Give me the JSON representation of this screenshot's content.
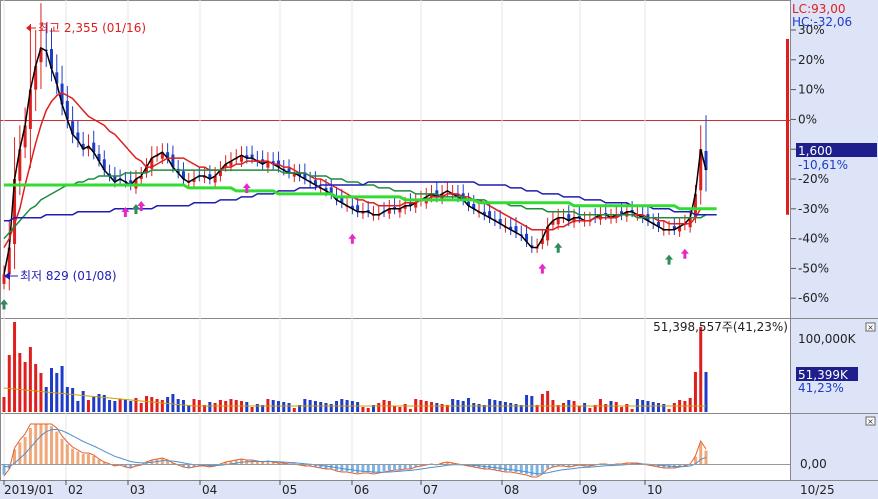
{
  "colors": {
    "up": "#e01e1e",
    "down": "#1e3cc8",
    "ma5": "#000000",
    "ma20": "#e01e1e",
    "ma60": "#1e8c3c",
    "ma120": "#1e1eb4",
    "ma240": "#32dc32",
    "panel_bg": "#dde4f7",
    "ref_line": "#c83232",
    "buy_arrow": "#e628c8",
    "sell_arrow": "#2d8c5a"
  },
  "price_panel": {
    "lc_label": "LC:93,00",
    "hc_label": "HC:-32,06",
    "high_label": "최고 2,355 (01/16)",
    "low_label": "최저 829 (01/08)",
    "current_price": "1,600",
    "current_change": "-10,61%",
    "y_ticks": [
      "30%",
      "20%",
      "10%",
      "0%",
      "-10%",
      "-20%",
      "-30%",
      "-40%",
      "-50%",
      "-60%"
    ]
  },
  "volume_panel": {
    "header": "51,398,557주(41,23%)",
    "scale_label": "100,000K",
    "current_volume": "51,399K",
    "current_pct": "41,23%"
  },
  "macd_panel": {
    "zero_label": "0,00"
  },
  "x_axis": {
    "labels": [
      "2019/01",
      "02",
      "03",
      "04",
      "05",
      "06",
      "07",
      "08",
      "09",
      "10"
    ],
    "right_label": "10/25"
  },
  "chart_data": {
    "type": "line",
    "y_unit": "% change from reference (LC)",
    "ylim": [
      -65,
      35
    ],
    "series": [
      {
        "name": "",
        "values": [
          -52,
          -43,
          -20,
          -10,
          -2,
          10,
          18,
          24,
          23,
          17,
          12,
          5,
          0,
          -5,
          -7,
          -10,
          -9,
          -11,
          -14,
          -17,
          -19,
          -21,
          -20,
          -21,
          -22,
          -20,
          -19,
          -16,
          -13,
          -12,
          -11,
          -13,
          -16,
          -18,
          -20,
          -21,
          -20,
          -19,
          -19,
          -20,
          -19,
          -17,
          -15,
          -14,
          -13,
          -12,
          -13,
          -13,
          -14,
          -15,
          -14,
          -15,
          -16,
          -17,
          -18,
          -18,
          -19,
          -20,
          -21,
          -22,
          -23,
          -24,
          -25,
          -27,
          -28,
          -29,
          -30,
          -31,
          -31,
          -31,
          -32,
          -32,
          -31,
          -30,
          -30,
          -30,
          -29,
          -29,
          -28,
          -27,
          -26,
          -25,
          -26,
          -25,
          -24,
          -25,
          -26,
          -27,
          -29,
          -30,
          -31,
          -32,
          -33,
          -34,
          -35,
          -36,
          -37,
          -38,
          -39,
          -41,
          -43,
          -43,
          -40,
          -36,
          -34,
          -33,
          -33,
          -34,
          -33,
          -33,
          -34,
          -34,
          -33,
          -32,
          -32,
          -33,
          -32,
          -32,
          -31,
          -31,
          -32,
          -33,
          -34,
          -35,
          -36,
          -37,
          -37,
          -37,
          -36,
          -35,
          -33,
          -25,
          -10,
          -17
        ]
      },
      {
        "name": "",
        "values": [
          -43,
          -40,
          -35,
          -30,
          -22,
          -15,
          -8,
          -2,
          3,
          6,
          8,
          9,
          8,
          7,
          5,
          3,
          1,
          0,
          -1,
          -2,
          -4,
          -5,
          -7,
          -9,
          -11,
          -13,
          -14,
          -16,
          -16,
          -15,
          -14,
          -13,
          -13,
          -13,
          -13,
          -14,
          -15,
          -16,
          -16,
          -17,
          -17,
          -17,
          -16,
          -16,
          -15,
          -15,
          -14,
          -14,
          -14,
          -14,
          -14,
          -15,
          -15,
          -16,
          -16,
          -17,
          -18,
          -18,
          -19,
          -20,
          -20,
          -21,
          -22,
          -23,
          -24,
          -25,
          -26,
          -27,
          -27,
          -28,
          -28,
          -29,
          -29,
          -29,
          -29,
          -29,
          -28,
          -28,
          -28,
          -27,
          -27,
          -26,
          -26,
          -26,
          -25,
          -25,
          -25,
          -26,
          -26,
          -27,
          -27,
          -28,
          -29,
          -30,
          -31,
          -32,
          -33,
          -34,
          -35,
          -36,
          -37,
          -37,
          -37,
          -37,
          -37,
          -36,
          -36,
          -35,
          -34,
          -34,
          -34,
          -34,
          -33,
          -33,
          -33,
          -33,
          -33,
          -32,
          -32,
          -32,
          -32,
          -32,
          -33,
          -33,
          -34,
          -34,
          -35,
          -35,
          -35,
          -35,
          -35,
          -33,
          -30,
          -30
        ]
      },
      {
        "name": "",
        "values": [
          -40,
          -38,
          -36,
          -34,
          -32,
          -30,
          -29,
          -27,
          -26,
          -25,
          -24,
          -23,
          -22,
          -22,
          -21,
          -21,
          -20,
          -20,
          -19,
          -19,
          -19,
          -19,
          -19,
          -18,
          -18,
          -18,
          -18,
          -18,
          -17,
          -17,
          -17,
          -17,
          -17,
          -17,
          -17,
          -17,
          -17,
          -17,
          -17,
          -17,
          -17,
          -17,
          -17,
          -17,
          -17,
          -17,
          -17,
          -17,
          -17,
          -17,
          -17,
          -17,
          -17,
          -18,
          -18,
          -18,
          -18,
          -18,
          -19,
          -19,
          -19,
          -19,
          -20,
          -20,
          -20,
          -21,
          -21,
          -21,
          -22,
          -22,
          -22,
          -23,
          -23,
          -23,
          -24,
          -24,
          -24,
          -24,
          -25,
          -25,
          -25,
          -25,
          -25,
          -26,
          -26,
          -26,
          -26,
          -26,
          -27,
          -27,
          -27,
          -27,
          -28,
          -28,
          -28,
          -28,
          -29,
          -29,
          -29,
          -30,
          -30,
          -30,
          -30,
          -31,
          -31,
          -31,
          -31,
          -31,
          -31,
          -32,
          -32,
          -32,
          -32,
          -32,
          -32,
          -32,
          -32,
          -32,
          -32,
          -32,
          -33,
          -33,
          -33,
          -33,
          -33,
          -33,
          -33,
          -33,
          -33,
          -33,
          -33,
          -33,
          -33,
          -32,
          -32,
          -32
        ]
      },
      {
        "name": "",
        "values": [
          -34,
          -34,
          -33,
          -33,
          -33,
          -33,
          -33,
          -33,
          -32,
          -32,
          -32,
          -32,
          -32,
          -32,
          -31,
          -31,
          -31,
          -31,
          -31,
          -31,
          -31,
          -30,
          -30,
          -30,
          -30,
          -30,
          -30,
          -30,
          -30,
          -29,
          -29,
          -29,
          -29,
          -29,
          -29,
          -29,
          -28,
          -28,
          -28,
          -28,
          -28,
          -27,
          -27,
          -27,
          -27,
          -26,
          -26,
          -26,
          -25,
          -25,
          -25,
          -25,
          -24,
          -24,
          -24,
          -24,
          -23,
          -23,
          -23,
          -23,
          -22,
          -22,
          -22,
          -22,
          -22,
          -22,
          -22,
          -22,
          -22,
          -21,
          -21,
          -21,
          -21,
          -21,
          -21,
          -21,
          -21,
          -21,
          -21,
          -21,
          -21,
          -21,
          -21,
          -21,
          -21,
          -21,
          -21,
          -21,
          -21,
          -21,
          -22,
          -22,
          -22,
          -22,
          -22,
          -22,
          -23,
          -23,
          -23,
          -24,
          -24,
          -24,
          -25,
          -25,
          -25,
          -25,
          -26,
          -26,
          -26,
          -26,
          -27,
          -27,
          -27,
          -27,
          -28,
          -28,
          -28,
          -28,
          -28,
          -29,
          -29,
          -29,
          -29,
          -30,
          -30,
          -30,
          -30,
          -31,
          -31,
          -31,
          -31,
          -32,
          -32,
          -32,
          -32,
          -32
        ]
      },
      {
        "name": "",
        "values": [
          -22,
          -22,
          -22,
          -22,
          -22,
          -22,
          -22,
          -22,
          -22,
          -22,
          -22,
          -22,
          -22,
          -22,
          -22,
          -22,
          -22,
          -22,
          -22,
          -22,
          -22,
          -22,
          -22,
          -22,
          -22,
          -22,
          -22,
          -22,
          -22,
          -22,
          -22,
          -22,
          -22,
          -22,
          -22,
          -23,
          -23,
          -23,
          -23,
          -23,
          -23,
          -23,
          -23,
          -23,
          -24,
          -24,
          -24,
          -24,
          -24,
          -24,
          -24,
          -24,
          -25,
          -25,
          -25,
          -25,
          -25,
          -25,
          -25,
          -25,
          -25,
          -25,
          -25,
          -26,
          -26,
          -26,
          -26,
          -26,
          -26,
          -26,
          -26,
          -26,
          -26,
          -26,
          -26,
          -26,
          -27,
          -27,
          -27,
          -27,
          -27,
          -27,
          -27,
          -27,
          -27,
          -27,
          -27,
          -27,
          -27,
          -27,
          -28,
          -28,
          -28,
          -28,
          -28,
          -28,
          -28,
          -28,
          -28,
          -28,
          -28,
          -28,
          -28,
          -28,
          -28,
          -28,
          -28,
          -28,
          -29,
          -29,
          -29,
          -29,
          -29,
          -29,
          -29,
          -29,
          -29,
          -29,
          -29,
          -29,
          -29,
          -29,
          -29,
          -29,
          -29,
          -29,
          -29,
          -29,
          -30,
          -30,
          -30,
          -30,
          -30,
          -30,
          -30,
          -30
        ]
      }
    ]
  }
}
